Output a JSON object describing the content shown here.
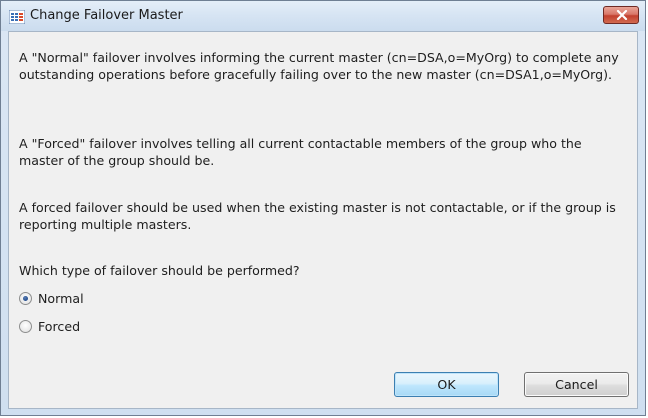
{
  "window": {
    "title": "Change Failover Master",
    "icon": "failover-app-icon",
    "close_icon": "close-icon"
  },
  "content": {
    "paragraph1": "A \"Normal\" failover involves informing the current master (cn=DSA,o=MyOrg) to complete any outstanding operations before gracefully failing over to the new master (cn=DSA1,o=MyOrg).",
    "paragraph2": "A \"Forced\" failover involves telling all current contactable members of the group who the master of the group should be.",
    "paragraph3": "A forced failover should be used when the existing master is not contactable, or if the group is reporting multiple masters.",
    "question": "Which type of failover should be performed?"
  },
  "options": [
    {
      "label": "Normal",
      "selected": true
    },
    {
      "label": "Forced",
      "selected": false
    }
  ],
  "buttons": {
    "ok_label": "OK",
    "cancel_label": "Cancel"
  },
  "colors": {
    "close_button": "#c2402f",
    "default_button_border": "#3c7fb1"
  }
}
